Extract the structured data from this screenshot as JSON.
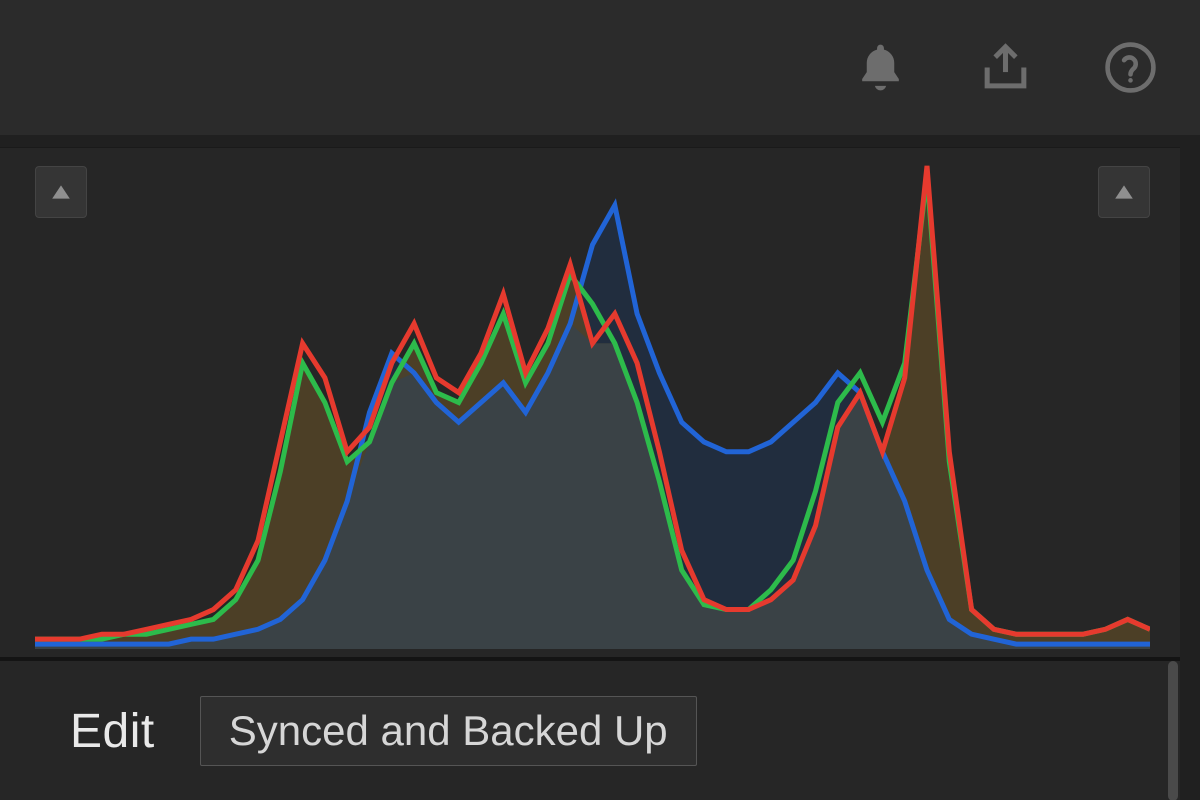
{
  "toolbar": {
    "icons": {
      "notifications": "notifications-icon",
      "share": "share-icon",
      "help": "help-icon"
    }
  },
  "histogram": {
    "colors": {
      "red": "#e63a2e",
      "green": "#2dbb4b",
      "blue": "#2164d6",
      "fill_overlap": "#3a4246",
      "fill_rg": "#5c4a27",
      "fill_b": "#1d3352"
    }
  },
  "bottom": {
    "edit_label": "Edit",
    "sync_status": "Synced and Backed Up"
  },
  "chart_data": {
    "type": "area",
    "title": "RGB Histogram",
    "xlabel": "",
    "ylabel": "",
    "x": [
      0,
      2,
      4,
      6,
      8,
      10,
      12,
      14,
      16,
      18,
      20,
      22,
      24,
      26,
      28,
      30,
      32,
      34,
      36,
      38,
      40,
      42,
      44,
      46,
      48,
      50,
      52,
      54,
      56,
      58,
      60,
      62,
      64,
      66,
      68,
      70,
      72,
      74,
      76,
      78,
      80,
      82,
      84,
      86,
      88,
      90,
      92,
      94,
      96,
      98,
      100
    ],
    "xlim": [
      0,
      100
    ],
    "ylim": [
      0,
      100
    ],
    "series": [
      {
        "name": "red",
        "color": "#e63a2e",
        "values": [
          2,
          2,
          2,
          3,
          3,
          4,
          5,
          6,
          8,
          12,
          22,
          42,
          62,
          55,
          40,
          45,
          58,
          66,
          55,
          52,
          60,
          72,
          56,
          65,
          78,
          62,
          68,
          58,
          40,
          20,
          10,
          8,
          8,
          10,
          14,
          25,
          45,
          52,
          40,
          55,
          98,
          40,
          8,
          4,
          3,
          3,
          3,
          3,
          4,
          6,
          4
        ]
      },
      {
        "name": "green",
        "color": "#2dbb4b",
        "values": [
          2,
          2,
          2,
          2,
          3,
          3,
          4,
          5,
          6,
          10,
          18,
          36,
          58,
          50,
          38,
          42,
          54,
          62,
          52,
          50,
          58,
          68,
          54,
          62,
          76,
          70,
          62,
          50,
          34,
          16,
          9,
          8,
          8,
          12,
          18,
          32,
          50,
          56,
          46,
          58,
          96,
          38,
          8,
          4,
          3,
          3,
          3,
          3,
          4,
          6,
          4
        ]
      },
      {
        "name": "blue",
        "color": "#2164d6",
        "values": [
          1,
          1,
          1,
          1,
          1,
          1,
          1,
          2,
          2,
          3,
          4,
          6,
          10,
          18,
          30,
          48,
          60,
          56,
          50,
          46,
          50,
          54,
          48,
          56,
          66,
          82,
          90,
          68,
          56,
          46,
          42,
          40,
          40,
          42,
          46,
          50,
          56,
          52,
          40,
          30,
          16,
          6,
          3,
          2,
          1,
          1,
          1,
          1,
          1,
          1,
          1
        ]
      }
    ]
  }
}
